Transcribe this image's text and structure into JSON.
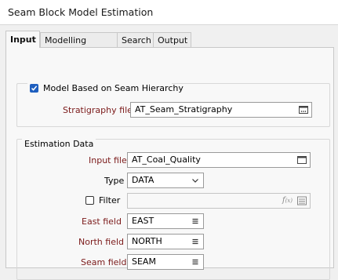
{
  "window": {
    "title": "Seam Block Model Estimation"
  },
  "tabs": [
    {
      "label": "Input"
    },
    {
      "label": "Modelling Method"
    },
    {
      "label": "Search"
    },
    {
      "label": "Output"
    }
  ],
  "hierarchy_group": {
    "checkbox_label": "Model Based on Seam Hierarchy",
    "checked": true,
    "stratigraphy_label": "Stratigraphy file",
    "stratigraphy_value": "AT_Seam_Stratigraphy"
  },
  "estimation_group": {
    "title": "Estimation Data",
    "input_file_label": "Input file",
    "input_file_value": "AT_Coal_Quality",
    "type_label": "Type",
    "type_value": "DATA",
    "filter_label": "Filter",
    "filter_checked": false,
    "filter_value": "",
    "east_label": "East field",
    "east_value": "EAST",
    "north_label": "North field",
    "north_value": "NORTH",
    "seam_label": "Seam field",
    "seam_value": "SEAM"
  },
  "icons": {
    "browse": "browse-file-icon",
    "list": "field-list-icon",
    "dropdown": "chevron-down-icon",
    "expression": "fx-expression-icon"
  }
}
